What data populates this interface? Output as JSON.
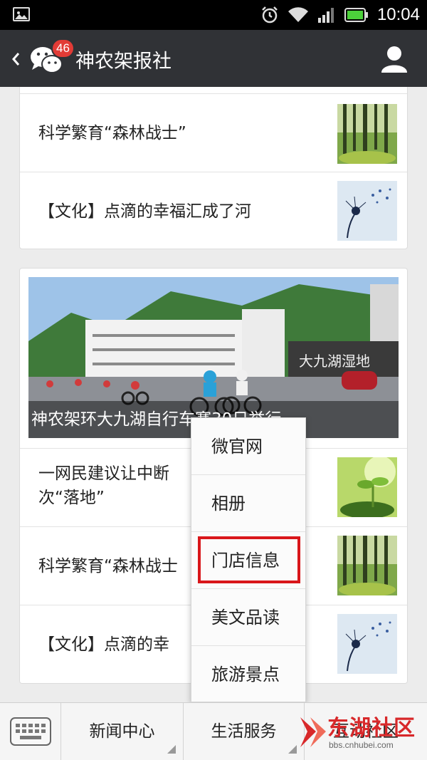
{
  "status_bar": {
    "time": "10:04"
  },
  "header": {
    "title": "神农架报社",
    "badge": "46"
  },
  "card1": {
    "rows": [
      {
        "title": "科学繁育“森林战士”",
        "thumb": "forest-thumbnail"
      },
      {
        "title": "【文化】点滴的幸福汇成了河",
        "thumb": "dandelion-thumbnail"
      }
    ]
  },
  "card2": {
    "hero_caption": "神农架环大九湖自行车赛30日举行",
    "hero_sign": "大九湖湿地",
    "rows": [
      {
        "title_line1": "一网民建议让中断",
        "title_line2": "次“落地”",
        "thumb": "sprout-thumbnail"
      },
      {
        "title": "科学繁育“森林战士",
        "thumb": "forest-thumbnail"
      },
      {
        "title": "【文化】点滴的幸",
        "thumb": "dandelion-thumbnail"
      }
    ]
  },
  "popup_menu": {
    "items": [
      "微官网",
      "相册",
      "门店信息",
      "美文品读",
      "旅游景点"
    ],
    "highlighted_index": 2,
    "highlight_color": "#d9161a"
  },
  "bottom_bar": {
    "tabs": [
      "新闻中心",
      "生活服务",
      "互动社区"
    ],
    "watermark": "东湖社区",
    "watermark_url": "bbs.cnhubei.com"
  },
  "colors": {
    "title_bar": "#303236",
    "badge": "#e23b36",
    "battery": "#4cd13b"
  }
}
